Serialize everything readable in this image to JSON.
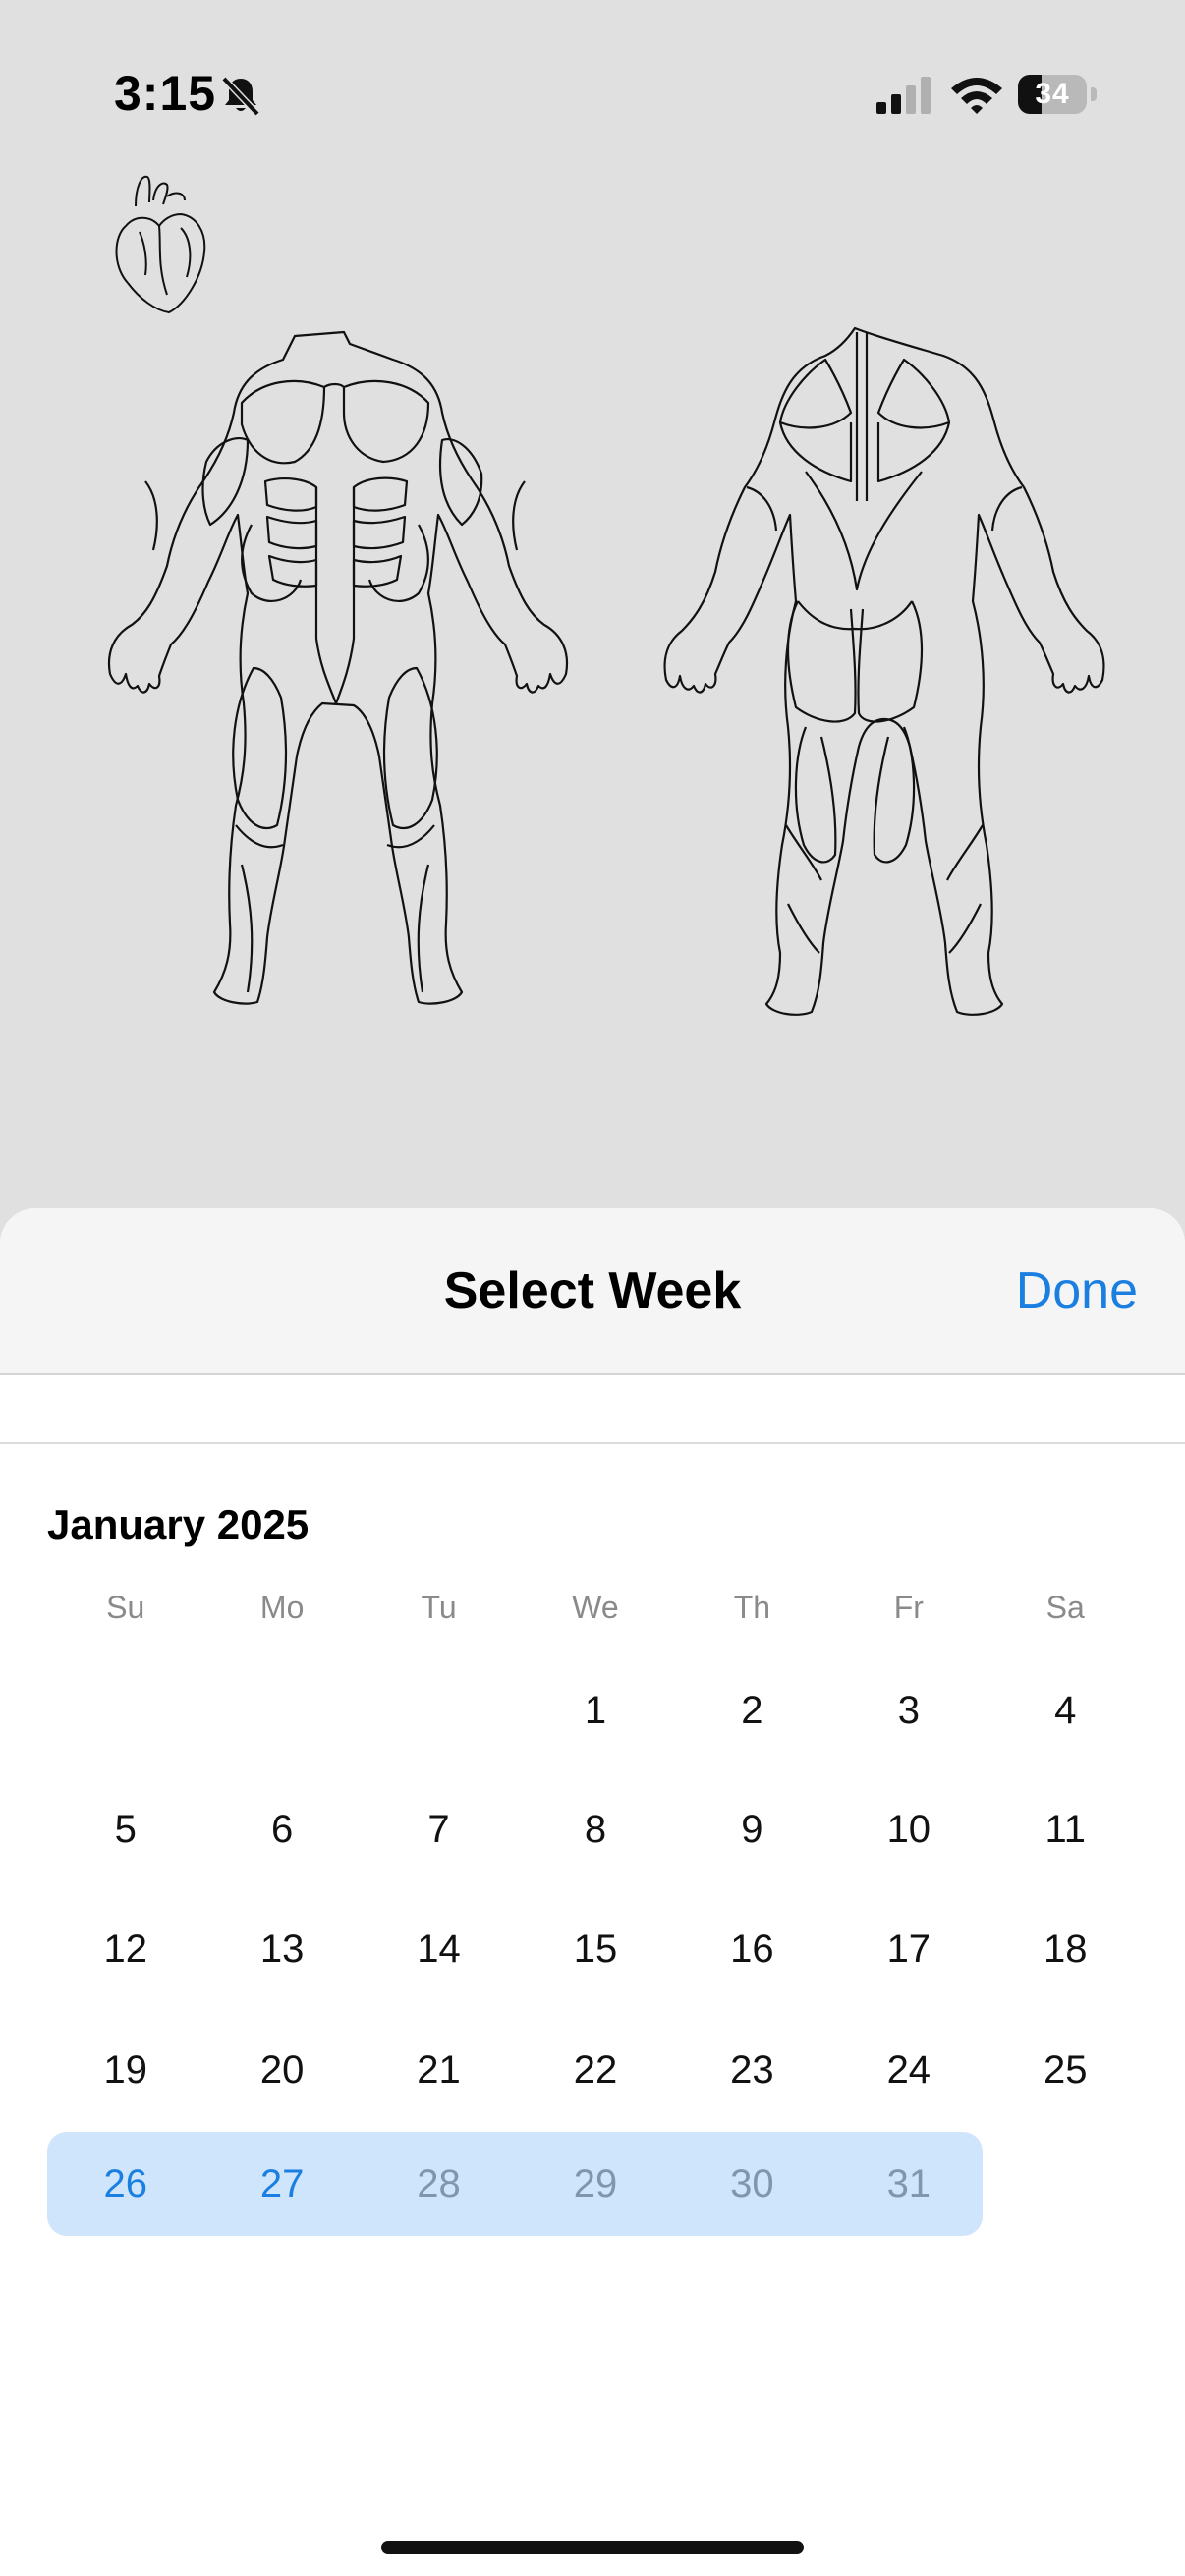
{
  "status_bar": {
    "time": "3:15",
    "battery_level": "34",
    "icons": [
      "bell-slash-icon",
      "cellular-signal-icon",
      "wifi-icon",
      "battery-icon"
    ]
  },
  "illustration": {
    "icons": [
      "heart-outline-icon",
      "body-front-outline",
      "body-back-outline"
    ]
  },
  "sheet": {
    "title": "Select Week",
    "done_label": "Done",
    "accent_color": "#1a7fe0",
    "selection_color": "#cfe5fb"
  },
  "calendar": {
    "month_label": "January 2025",
    "weekdays": [
      "Su",
      "Mo",
      "Tu",
      "We",
      "Th",
      "Fr",
      "Sa"
    ],
    "weeks": [
      [
        "",
        "",
        "",
        "1",
        "2",
        "3",
        "4"
      ],
      [
        "5",
        "6",
        "7",
        "8",
        "9",
        "10",
        "11"
      ],
      [
        "12",
        "13",
        "14",
        "15",
        "16",
        "17",
        "18"
      ],
      [
        "19",
        "20",
        "21",
        "22",
        "23",
        "24",
        "25"
      ],
      [
        "26",
        "27",
        "28",
        "29",
        "30",
        "31",
        ""
      ]
    ],
    "selected_week_index": 4,
    "selected_active_days": [
      "26",
      "27"
    ],
    "selected_muted_days": [
      "28",
      "29",
      "30",
      "31"
    ]
  }
}
